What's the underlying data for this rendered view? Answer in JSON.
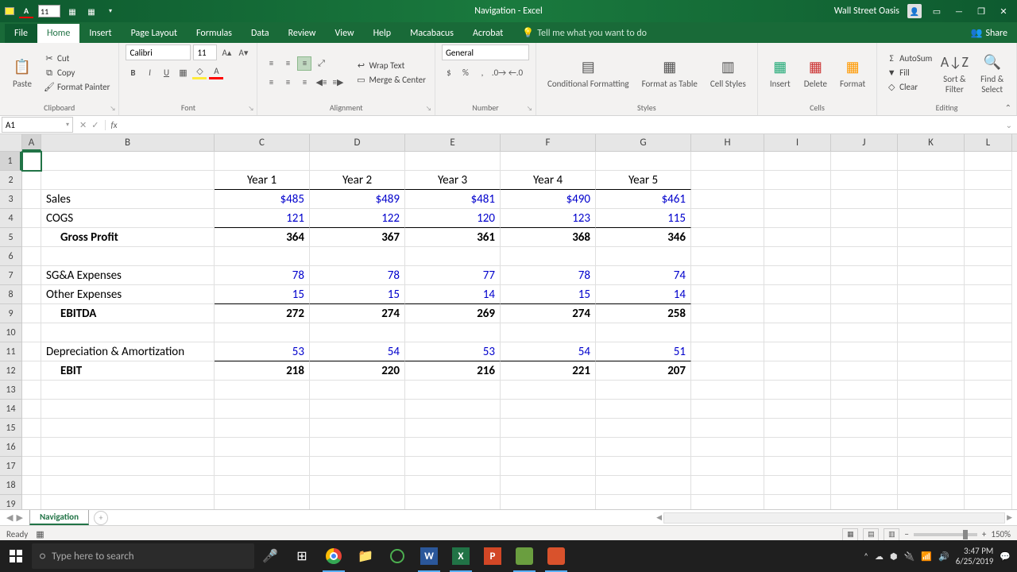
{
  "titlebar": {
    "qat_font_size": "11",
    "title": "Navigation  -  Excel",
    "username": "Wall Street Oasis"
  },
  "tabs": {
    "file": "File",
    "home": "Home",
    "insert": "Insert",
    "page_layout": "Page Layout",
    "formulas": "Formulas",
    "data": "Data",
    "review": "Review",
    "view": "View",
    "help": "Help",
    "macabacus": "Macabacus",
    "acrobat": "Acrobat",
    "tell_me": "Tell me what you want to do",
    "share": "Share"
  },
  "ribbon": {
    "clipboard": {
      "label": "Clipboard",
      "paste": "Paste",
      "cut": "Cut",
      "copy": "Copy",
      "format_painter": "Format Painter"
    },
    "font": {
      "label": "Font",
      "name": "Calibri",
      "size": "11"
    },
    "alignment": {
      "label": "Alignment",
      "wrap": "Wrap Text",
      "merge": "Merge & Center"
    },
    "number": {
      "label": "Number",
      "format": "General"
    },
    "styles": {
      "label": "Styles",
      "cond": "Conditional Formatting",
      "table": "Format as Table",
      "cell": "Cell Styles"
    },
    "cells": {
      "label": "Cells",
      "insert": "Insert",
      "delete": "Delete",
      "format": "Format"
    },
    "editing": {
      "label": "Editing",
      "autosum": "AutoSum",
      "fill": "Fill",
      "clear": "Clear",
      "sort": "Sort & Filter",
      "find": "Find & Select"
    }
  },
  "namebox": "A1",
  "formula": "",
  "columns": [
    "A",
    "B",
    "C",
    "D",
    "E",
    "F",
    "G",
    "H",
    "I",
    "J",
    "K",
    "L"
  ],
  "row_numbers": [
    1,
    2,
    3,
    4,
    5,
    6,
    7,
    8,
    9,
    10,
    11,
    12,
    13,
    14,
    15,
    16,
    17,
    18,
    19
  ],
  "sheet": {
    "headers": [
      "Year 1",
      "Year 2",
      "Year 3",
      "Year 4",
      "Year 5"
    ],
    "rows": [
      {
        "label": "Sales",
        "values": [
          "$485",
          "$489",
          "$481",
          "$490",
          "$461"
        ],
        "blue": true
      },
      {
        "label": "COGS",
        "values": [
          "121",
          "122",
          "120",
          "123",
          "115"
        ],
        "blue": true,
        "underline": true
      },
      {
        "label": "Gross Profit",
        "values": [
          "364",
          "367",
          "361",
          "368",
          "346"
        ],
        "bold": true,
        "indent": true
      },
      {
        "label": "",
        "values": [
          "",
          "",
          "",
          "",
          ""
        ]
      },
      {
        "label": "SG&A Expenses",
        "values": [
          "78",
          "78",
          "77",
          "78",
          "74"
        ],
        "blue": true
      },
      {
        "label": "Other Expenses",
        "values": [
          "15",
          "15",
          "14",
          "15",
          "14"
        ],
        "blue": true,
        "underline": true
      },
      {
        "label": "EBITDA",
        "values": [
          "272",
          "274",
          "269",
          "274",
          "258"
        ],
        "bold": true,
        "indent": true
      },
      {
        "label": "",
        "values": [
          "",
          "",
          "",
          "",
          ""
        ]
      },
      {
        "label": "Depreciation & Amortization",
        "values": [
          "53",
          "54",
          "53",
          "54",
          "51"
        ],
        "blue": true,
        "underline": true
      },
      {
        "label": "EBIT",
        "values": [
          "218",
          "220",
          "216",
          "221",
          "207"
        ],
        "bold": true,
        "indent": true
      }
    ]
  },
  "sheet_tab": "Navigation",
  "status": {
    "ready": "Ready",
    "zoom": "150%"
  },
  "taskbar": {
    "search_placeholder": "Type here to search",
    "time": "3:47 PM",
    "date": "6/25/2019"
  }
}
